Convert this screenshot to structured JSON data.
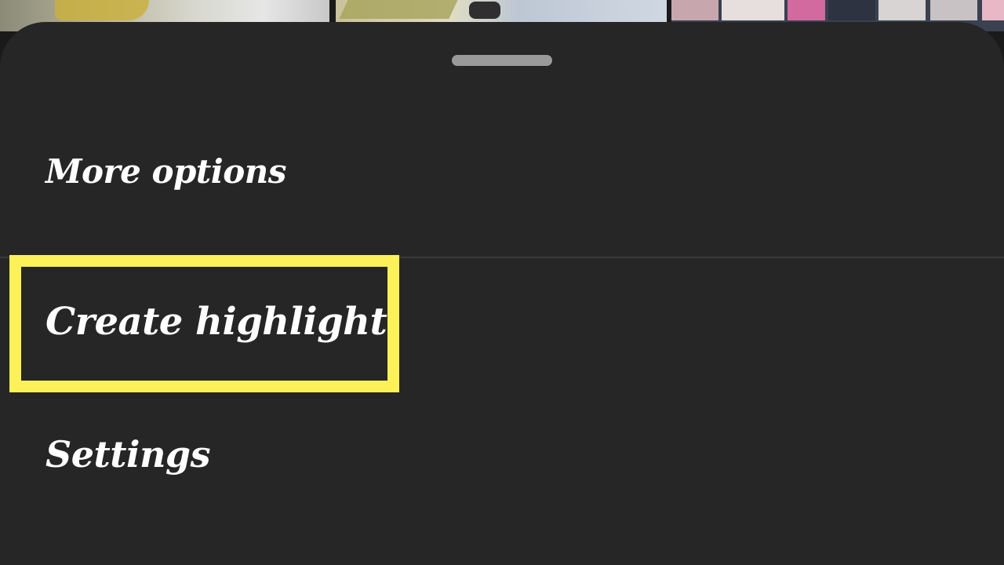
{
  "sheet": {
    "background_color": "#262626",
    "handle_color": "#9a9a9a",
    "highlight_color": "#fcf158"
  },
  "menu": {
    "more_options": "More options",
    "create_highlight": "Create highlight",
    "settings": "Settings"
  }
}
